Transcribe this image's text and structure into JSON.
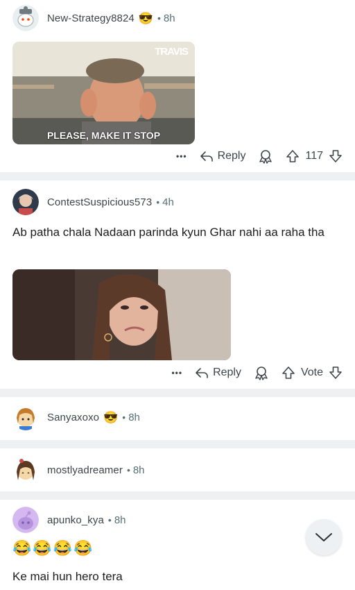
{
  "comments": [
    {
      "username": "New-Strategy8824",
      "flair_emoji": "😎",
      "time": "8h",
      "gif_caption": "PLEASE, MAKE IT STOP",
      "gif_watermark": "TRAVIS",
      "actions": {
        "reply_label": "Reply",
        "vote_count": "117"
      }
    },
    {
      "username": "ContestSuspicious573",
      "time": "4h",
      "text": "Ab patha chala Nadaan parinda kyun Ghar nahi aa raha tha",
      "actions": {
        "reply_label": "Reply",
        "vote_count": "Vote"
      }
    },
    {
      "username": "Sanyaxoxo",
      "flair_emoji": "😎",
      "time": "8h"
    },
    {
      "username": "mostlyadreamer",
      "time": "8h"
    },
    {
      "username": "apunko_kya",
      "time": "8h",
      "emoji_line": "😂😂😂😂",
      "text": "Ke mai hun hero tera"
    }
  ],
  "separator_dot": "•",
  "more_label": "•••",
  "icons": [
    "more-icon",
    "reply-icon",
    "award-icon",
    "upvote-icon",
    "downvote-icon",
    "chevron-down-icon"
  ]
}
